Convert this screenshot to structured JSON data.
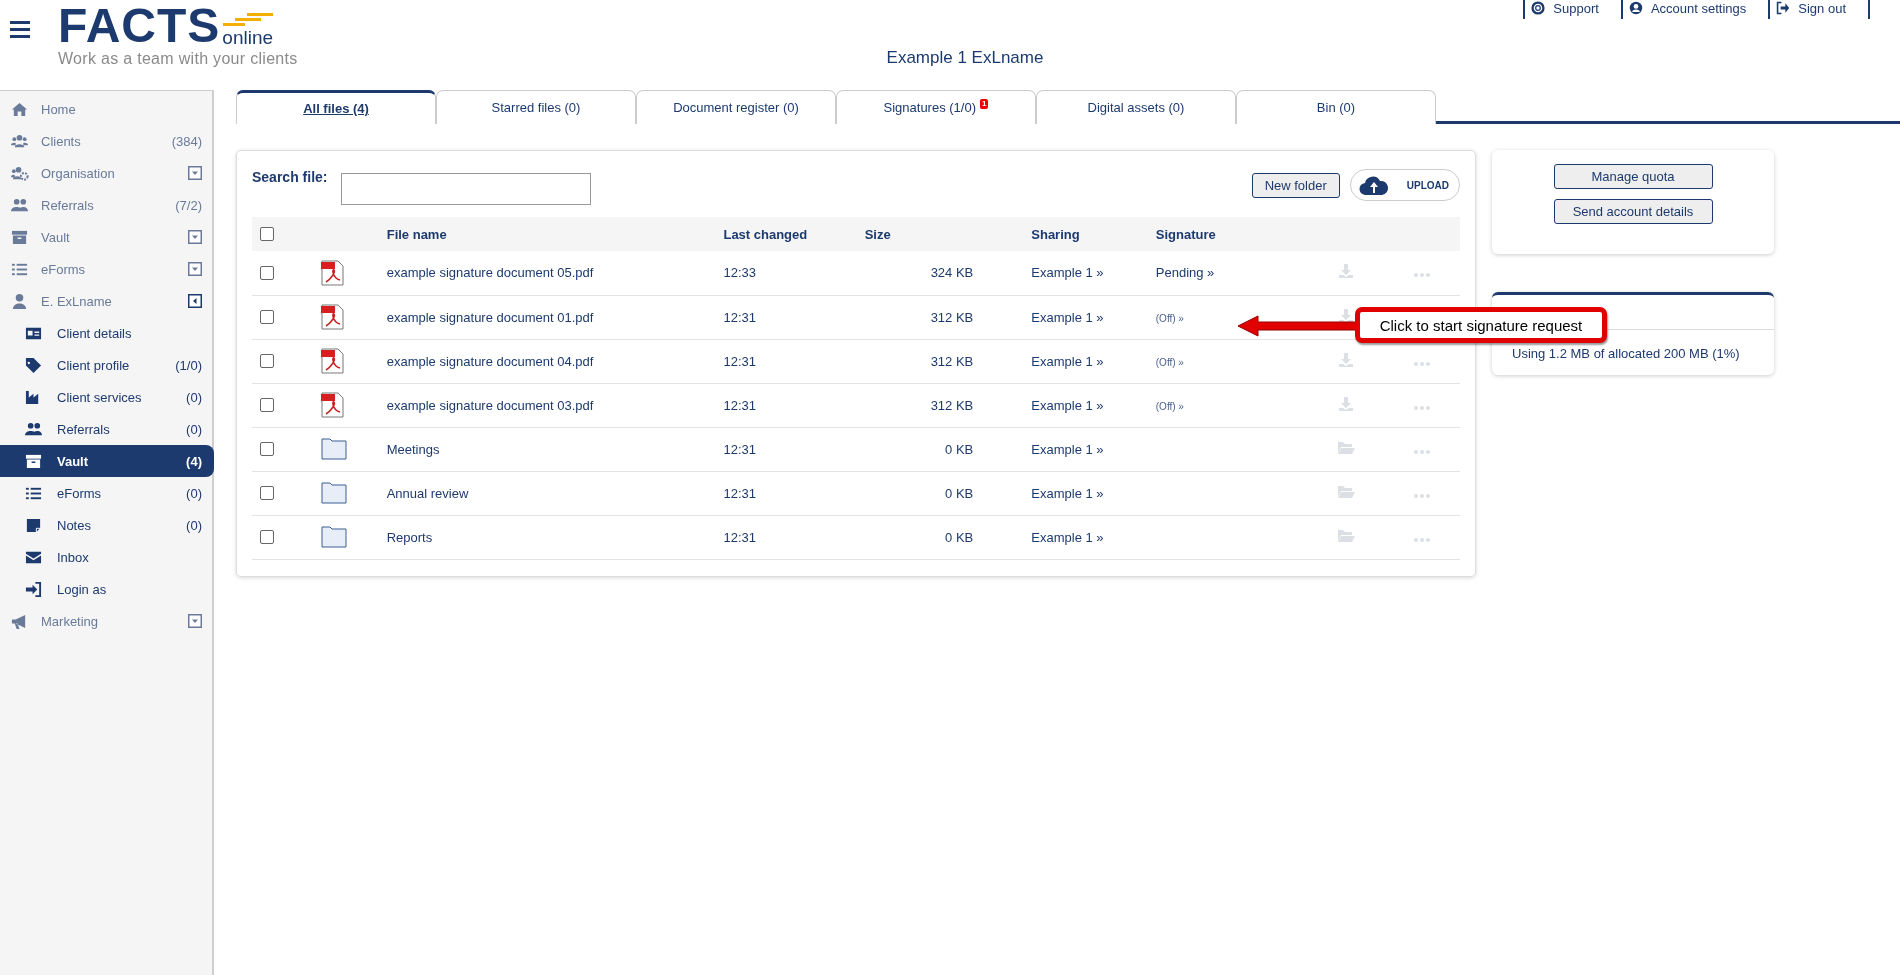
{
  "header": {
    "logo": {
      "brand": "FACTS",
      "suffix": "online",
      "tagline": "Work as a team with your clients"
    },
    "title": "Example 1 ExLname",
    "links": [
      {
        "label": "Support"
      },
      {
        "label": "Account settings"
      },
      {
        "label": "Sign out"
      }
    ]
  },
  "sidebar": {
    "items": [
      {
        "label": "Home",
        "selected": false
      },
      {
        "label": "Clients",
        "count": "(384)",
        "selected": false
      },
      {
        "label": "Organisation",
        "expanded": false,
        "selected": false
      },
      {
        "label": "Referrals",
        "count": "(7/2)",
        "selected": false
      },
      {
        "label": "Vault",
        "expanded": false,
        "selected": false
      },
      {
        "label": "eForms",
        "expanded": false,
        "selected": false
      },
      {
        "label": "E. ExLname",
        "expanded": true,
        "selected": false,
        "children": [
          {
            "label": "Client details",
            "selected": false
          },
          {
            "label": "Client profile",
            "count": "(1/0)",
            "selected": false
          },
          {
            "label": "Client services",
            "count": "(0)",
            "selected": false
          },
          {
            "label": "Referrals",
            "count": "(0)",
            "selected": false
          },
          {
            "label": "Vault",
            "count": "(4)",
            "selected": true
          },
          {
            "label": "eForms",
            "count": "(0)",
            "selected": false
          },
          {
            "label": "Notes",
            "count": "(0)",
            "selected": false
          },
          {
            "label": "Inbox",
            "selected": false
          },
          {
            "label": "Login as",
            "selected": false
          }
        ]
      },
      {
        "label": "Marketing",
        "expanded": false,
        "selected": false
      }
    ]
  },
  "tabs": [
    {
      "label": "All files (4)",
      "selected": true
    },
    {
      "label": "Starred files (0)",
      "selected": false
    },
    {
      "label": "Document register (0)",
      "selected": false
    },
    {
      "label": "Signatures (1/0)",
      "badge": "1",
      "selected": false
    },
    {
      "label": "Digital assets (0)",
      "selected": false
    },
    {
      "label": "Bin (0)",
      "selected": false
    }
  ],
  "files": {
    "search_label": "Search file:",
    "new_folder": "New folder",
    "upload": "UPLOAD",
    "header_checked": false,
    "columns": [
      "File name",
      "Last changed",
      "Size",
      "Sharing",
      "Signature"
    ],
    "rows": [
      {
        "kind": "pdf",
        "checked": false,
        "name": "example signature document 05.pdf",
        "changed": "12:33",
        "size": "324 KB",
        "sharing": "Example 1 »",
        "signature": "Pending »",
        "signature_off": false
      },
      {
        "kind": "pdf",
        "checked": false,
        "name": "example signature document 01.pdf",
        "changed": "12:31",
        "size": "312 KB",
        "sharing": "Example 1 »",
        "signature": "(Off) »",
        "signature_off": true
      },
      {
        "kind": "pdf",
        "checked": false,
        "name": "example signature document 04.pdf",
        "changed": "12:31",
        "size": "312 KB",
        "sharing": "Example 1 »",
        "signature": "(Off) »",
        "signature_off": true
      },
      {
        "kind": "pdf",
        "checked": false,
        "name": "example signature document 03.pdf",
        "changed": "12:31",
        "size": "312 KB",
        "sharing": "Example 1 »",
        "signature": "(Off) »",
        "signature_off": true
      },
      {
        "kind": "folder",
        "checked": false,
        "name": "Meetings",
        "changed": "12:31",
        "size": "0 KB",
        "sharing": "Example 1 »"
      },
      {
        "kind": "folder",
        "checked": false,
        "name": "Annual review",
        "changed": "12:31",
        "size": "0 KB",
        "sharing": "Example 1 »"
      },
      {
        "kind": "folder",
        "checked": false,
        "name": "Reports",
        "changed": "12:31",
        "size": "0 KB",
        "sharing": "Example 1 »"
      }
    ]
  },
  "quota": {
    "buttons": [
      "Manage quota",
      "Send account details"
    ],
    "usage": "Using 1.2 MB of allocated 200 MB (1%)"
  },
  "callout": {
    "text": "Click to start signature request"
  }
}
